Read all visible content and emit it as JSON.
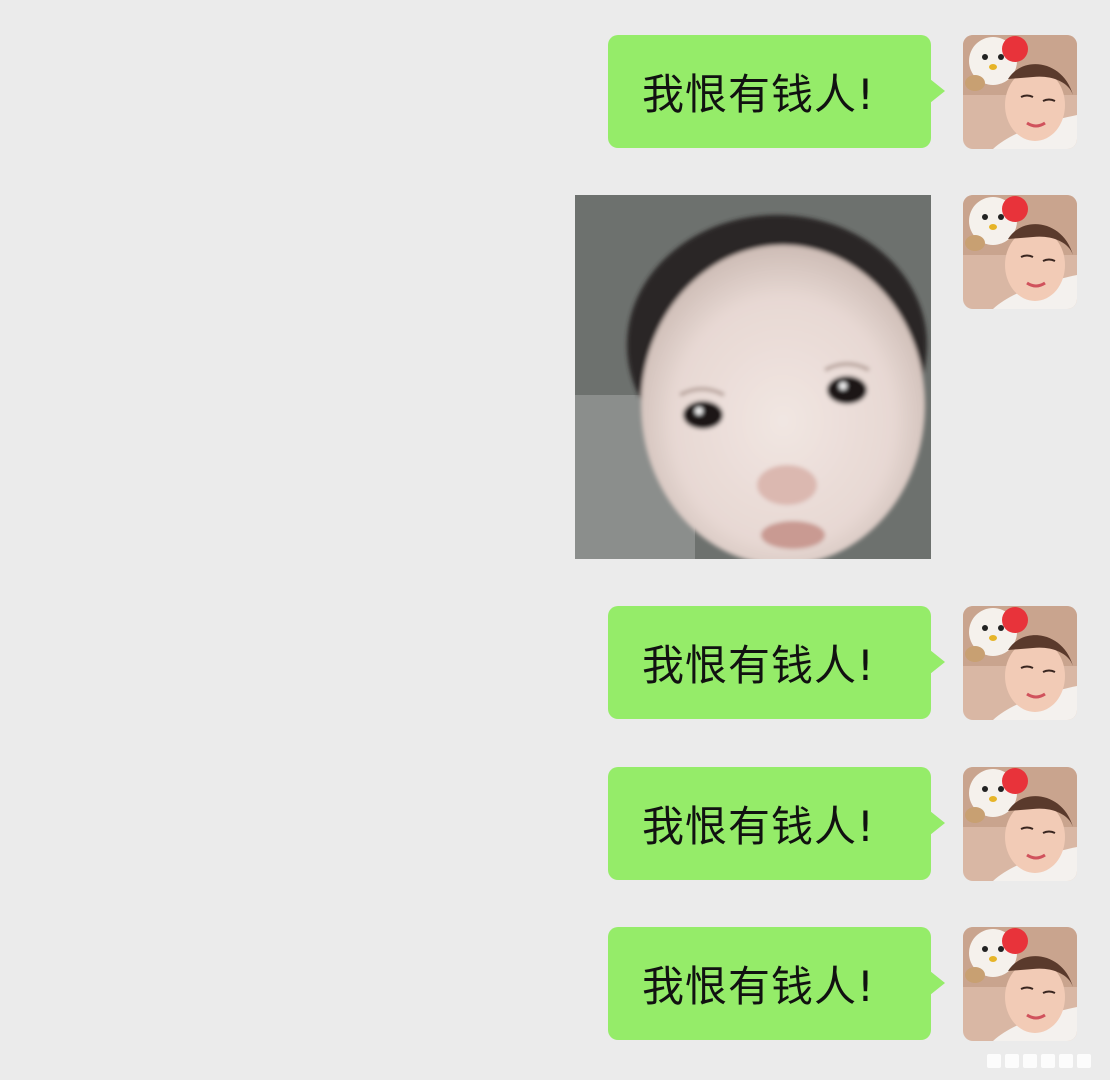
{
  "chat": {
    "messages": [
      {
        "type": "text",
        "sender": "self",
        "text": "我恨有钱人!"
      },
      {
        "type": "image",
        "sender": "self",
        "image": "baby-face-sticker"
      },
      {
        "type": "text",
        "sender": "self",
        "text": "我恨有钱人!"
      },
      {
        "type": "text",
        "sender": "self",
        "text": "我恨有钱人!"
      },
      {
        "type": "text",
        "sender": "self",
        "text": "我恨有钱人!"
      }
    ]
  },
  "colors": {
    "background": "#ebebeb",
    "bubble": "#95ec69",
    "text": "#111111"
  },
  "icons": {
    "avatar": "user-avatar-photo",
    "watermark": "watermark-logo"
  }
}
